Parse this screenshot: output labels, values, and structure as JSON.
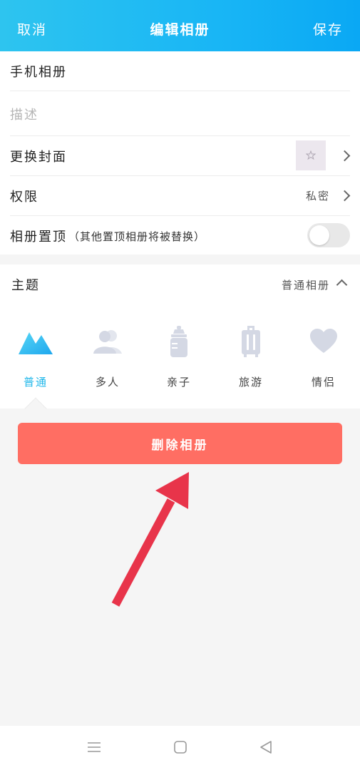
{
  "header": {
    "cancel": "取消",
    "title": "编辑相册",
    "save": "保存"
  },
  "form": {
    "album_name": "手机相册",
    "description_placeholder": "描述",
    "cover_label": "更换封面",
    "permission_label": "权限",
    "permission_value": "私密",
    "pin_label": "相册置顶",
    "pin_hint": "（其他置顶相册将被替换）",
    "pin_enabled": false
  },
  "theme": {
    "label": "主题",
    "value": "普通相册",
    "items": [
      {
        "label": "普通",
        "icon": "mountain-icon",
        "active": true
      },
      {
        "label": "多人",
        "icon": "people-icon",
        "active": false
      },
      {
        "label": "亲子",
        "icon": "baby-bottle-icon",
        "active": false
      },
      {
        "label": "旅游",
        "icon": "luggage-icon",
        "active": false
      },
      {
        "label": "情侣",
        "icon": "heart-icon",
        "active": false
      }
    ]
  },
  "delete_button": "删除相册",
  "colors": {
    "accent": "#1fb7ea",
    "delete": "#ff6e63",
    "annotation_arrow": "#e8344a",
    "icon_inactive": "#d4d8e4"
  }
}
